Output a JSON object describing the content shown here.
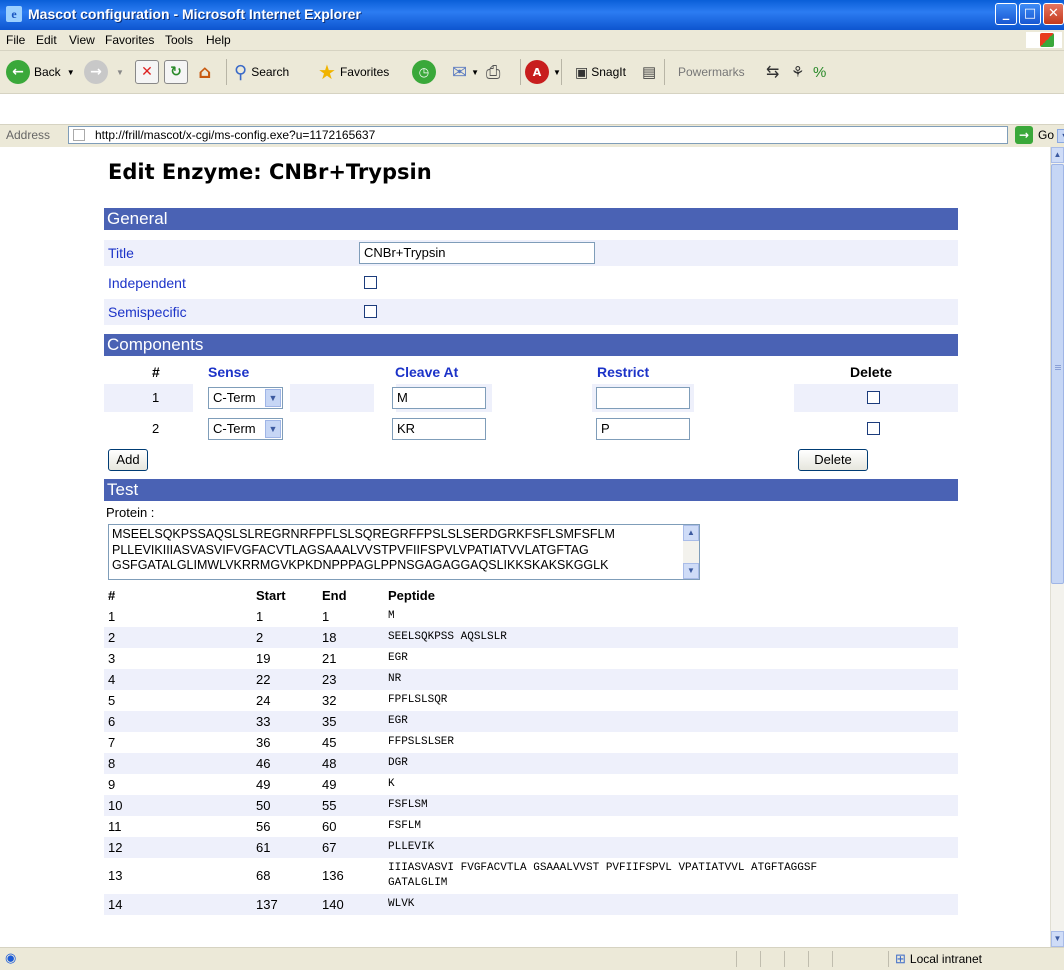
{
  "window": {
    "title": "Mascot configuration - Microsoft Internet Explorer"
  },
  "menu": [
    "File",
    "Edit",
    "View",
    "Favorites",
    "Tools",
    "Help"
  ],
  "toolbar": {
    "back": "Back",
    "search": "Search",
    "favorites": "Favorites",
    "snagit": "SnagIt",
    "powermarks": "Powermarks"
  },
  "address": {
    "label": "Address",
    "url": "http://frill/mascot/x-cgi/ms-config.exe?u=1172165637",
    "go": "Go"
  },
  "page": {
    "title": "Edit Enzyme: CNBr+Trypsin"
  },
  "general": {
    "header": "General",
    "title_label": "Title",
    "title_value": "CNBr+Trypsin",
    "independent_label": "Independent",
    "semispecific_label": "Semispecific"
  },
  "components": {
    "header": "Components",
    "cols": {
      "num": "#",
      "sense": "Sense",
      "cleave": "Cleave At",
      "restrict": "Restrict",
      "delete": "Delete"
    },
    "rows": [
      {
        "num": "1",
        "sense": "C-Term",
        "cleave": "M",
        "restrict": ""
      },
      {
        "num": "2",
        "sense": "C-Term",
        "cleave": "KR",
        "restrict": "P"
      }
    ],
    "add_button": "Add",
    "delete_button": "Delete"
  },
  "test": {
    "header": "Test",
    "protein_label": "Protein :",
    "protein_lines": [
      "MSEELSQKPSSAQSLSLREGRNRFPFLSLSQREGRFFPSLSLSERDGRKFSFLSMFSFLM",
      "PLLEVIKIIIASVASVIFVGFACVTLAGSAAALVVSTPVFIIFSPVLVPATIATVVLATGFTAG",
      "GSFGATALGLIMWLVKRRMGVKPKDNPPPAGLPPNSGAGAGGAQSLIKKSKAKSKGGLK"
    ],
    "cols": {
      "num": "#",
      "start": "Start",
      "end": "End",
      "peptide": "Peptide"
    },
    "rows": [
      {
        "num": "1",
        "start": "1",
        "end": "1",
        "peptide": "M"
      },
      {
        "num": "2",
        "start": "2",
        "end": "18",
        "peptide": "SEELSQKPSS AQSLSLR"
      },
      {
        "num": "3",
        "start": "19",
        "end": "21",
        "peptide": "EGR"
      },
      {
        "num": "4",
        "start": "22",
        "end": "23",
        "peptide": "NR"
      },
      {
        "num": "5",
        "start": "24",
        "end": "32",
        "peptide": "FPFLSLSQR"
      },
      {
        "num": "6",
        "start": "33",
        "end": "35",
        "peptide": "EGR"
      },
      {
        "num": "7",
        "start": "36",
        "end": "45",
        "peptide": "FFPSLSLSER"
      },
      {
        "num": "8",
        "start": "46",
        "end": "48",
        "peptide": "DGR"
      },
      {
        "num": "9",
        "start": "49",
        "end": "49",
        "peptide": "K"
      },
      {
        "num": "10",
        "start": "50",
        "end": "55",
        "peptide": "FSFLSM"
      },
      {
        "num": "11",
        "start": "56",
        "end": "60",
        "peptide": "FSFLM"
      },
      {
        "num": "12",
        "start": "61",
        "end": "67",
        "peptide": "PLLEVIK"
      },
      {
        "num": "13",
        "start": "68",
        "end": "136",
        "peptide": "IIIASVASVI FVGFACVTLA GSAAALVVST PVFIIFSPVL VPATIATVVL ATGFTAGGSF GATALGLIM"
      },
      {
        "num": "14",
        "start": "137",
        "end": "140",
        "peptide": "WLVK"
      }
    ]
  },
  "status": {
    "zone": "Local intranet"
  }
}
